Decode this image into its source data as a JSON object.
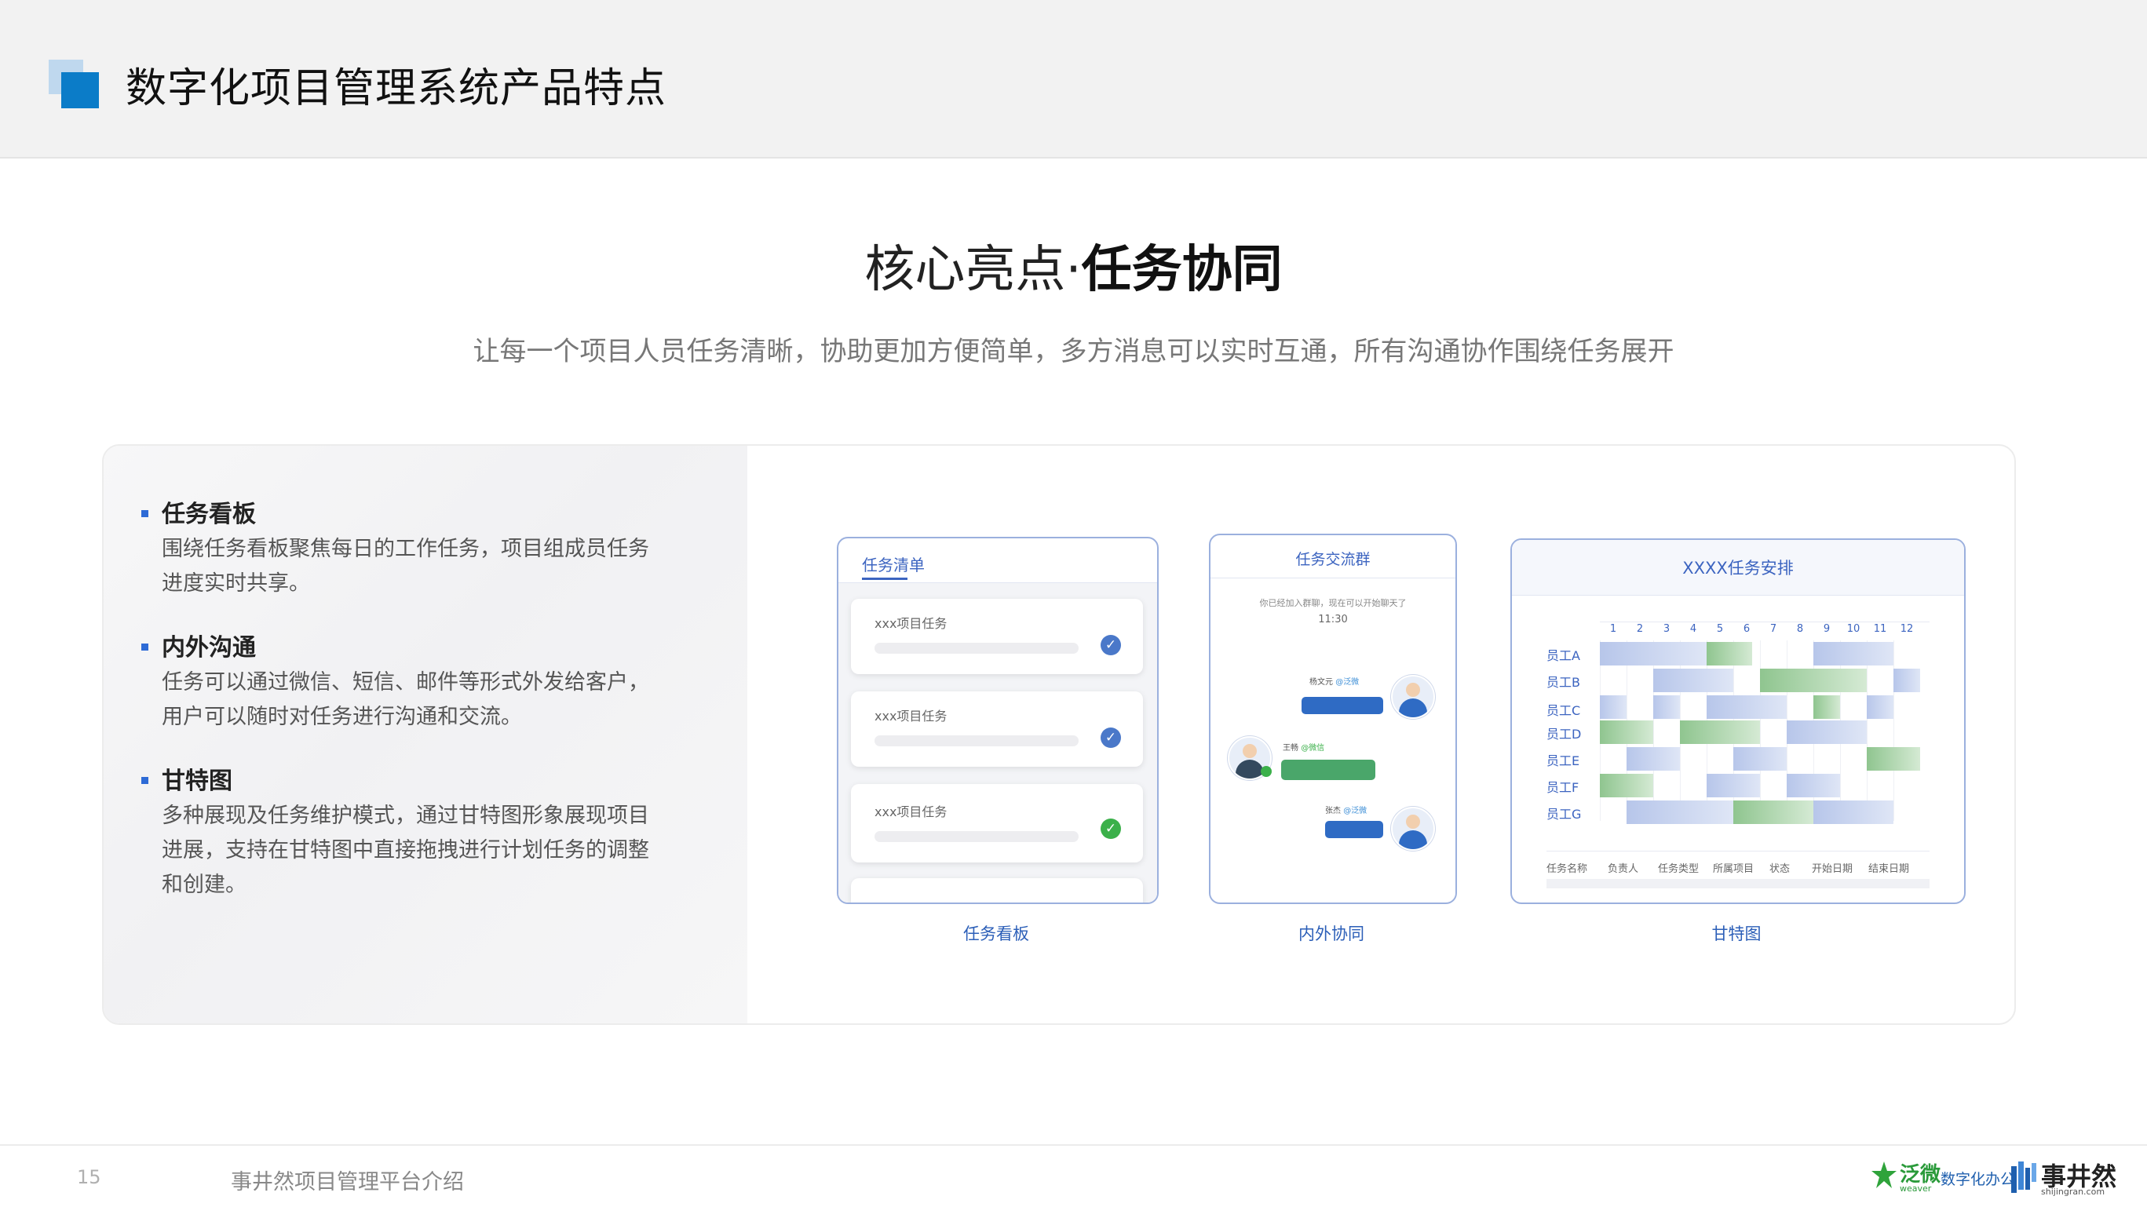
{
  "header": {
    "title": "数字化项目管理系统产品特点"
  },
  "hero": {
    "title_prefix": "核心亮点·",
    "title_bold": "任务协同",
    "subtitle": "让每一个项目人员任务清晰，协助更加方便简单，多方消息可以实时互通，所有沟通协作围绕任务展开"
  },
  "features": [
    {
      "title": "任务看板",
      "desc": "围绕任务看板聚焦每日的工作任务，项目组成员任务进度实时共享。"
    },
    {
      "title": "内外沟通",
      "desc": "任务可以通过微信、短信、邮件等形式外发给客户，用户可以随时对任务进行沟通和交流。"
    },
    {
      "title": "甘特图",
      "desc": "多种展现及任务维护模式，通过甘特图形象展现项目进展，支持在甘特图中直接拖拽进行计划任务的调整和创建。"
    }
  ],
  "task_board": {
    "tab": "任务清单",
    "items": [
      {
        "name": "xxx项目任务",
        "status": "done-blue"
      },
      {
        "name": "xxx项目任务",
        "status": "done-blue"
      },
      {
        "name": "xxx项目任务",
        "status": "done-green"
      }
    ],
    "caption": "任务看板"
  },
  "chat": {
    "title": "任务交流群",
    "system_msg": "你已经加入群聊，现在可以开始聊天了",
    "time": "11:30",
    "messages": [
      {
        "name": "杨文元",
        "tag": "@泛微",
        "side": "right"
      },
      {
        "name": "王畅",
        "tag": "@微信",
        "side": "left"
      },
      {
        "name": "张杰",
        "tag": "@泛微",
        "side": "right"
      }
    ],
    "caption": "内外协同"
  },
  "gantt": {
    "title": "XXXX任务安排",
    "months": [
      "1",
      "2",
      "3",
      "4",
      "5",
      "6",
      "7",
      "8",
      "9",
      "10",
      "11",
      "12"
    ],
    "rows": [
      "员工A",
      "员工B",
      "员工C",
      "员工D",
      "员工E",
      "员工F",
      "员工G"
    ],
    "footer_cols": [
      "任务名称",
      "负责人",
      "任务类型",
      "所属项目",
      "状态",
      "开始日期",
      "结束日期"
    ],
    "caption": "甘特图"
  },
  "footer": {
    "page_number": "15",
    "text": "事井然项目管理平台介绍",
    "brand1_name": "泛微",
    "brand1_en": "weaver",
    "brand1_slogan": "数字化办公",
    "brand2_name": "事井然",
    "brand2_url": "shijingran.com"
  },
  "colors": {
    "accent": "#0b7cc8",
    "panel_border": "#9bb0de",
    "check_blue": "#4a78c9",
    "check_green": "#3bb04a"
  }
}
